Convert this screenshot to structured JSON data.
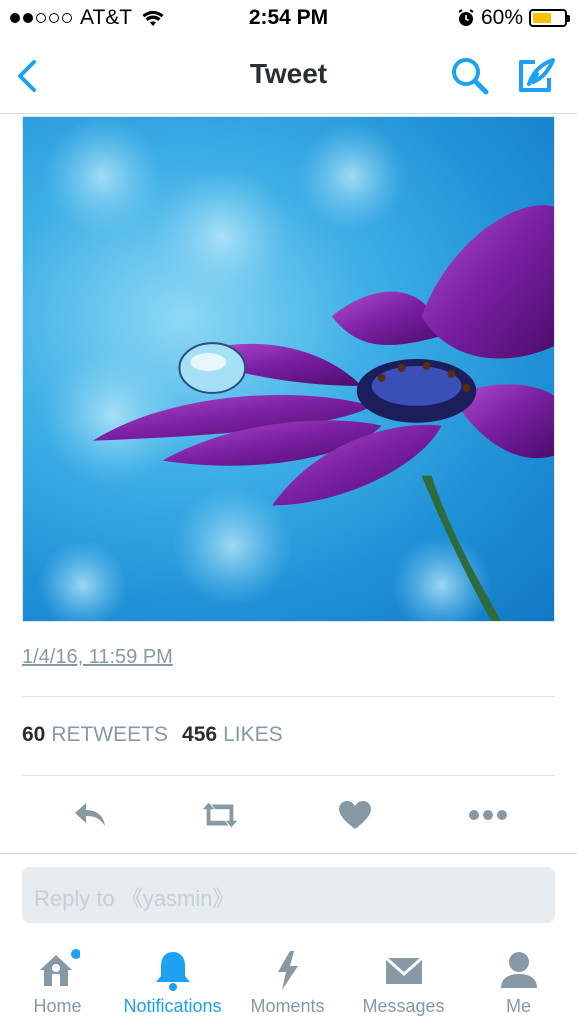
{
  "status_bar": {
    "carrier": "AT&T",
    "signal_bars_filled": 2,
    "signal_bars_total": 5,
    "time": "2:54 PM",
    "battery_percent": "60%",
    "battery_level": 0.6
  },
  "nav": {
    "title": "Tweet",
    "back_icon": "chevron-left-icon",
    "search_icon": "search-icon",
    "compose_icon": "compose-tweet-icon"
  },
  "tweet": {
    "image_alt": "purple-flower-with-water-drop",
    "timestamp": "1/4/16, 11:59 PM",
    "retweets_count": "60",
    "retweets_label": "RETWEETS",
    "likes_count": "456",
    "likes_label": "LIKES"
  },
  "actions": [
    "reply-icon",
    "retweet-icon",
    "like-icon",
    "more-icon"
  ],
  "reply": {
    "placeholder": "Reply to 《yasmin》"
  },
  "tab_bar": {
    "tabs": [
      {
        "label": "Home",
        "icon": "home-icon",
        "active": false,
        "badge": true
      },
      {
        "label": "Notifications",
        "icon": "bell-icon",
        "active": true,
        "badge": false
      },
      {
        "label": "Moments",
        "icon": "lightning-icon",
        "active": false,
        "badge": false
      },
      {
        "label": "Messages",
        "icon": "envelope-icon",
        "active": false,
        "badge": false
      },
      {
        "label": "Me",
        "icon": "person-icon",
        "active": false,
        "badge": false
      }
    ]
  },
  "colors": {
    "accent": "#1da1f2",
    "icon_gray": "#8899a6",
    "text_dark": "#292f33"
  }
}
